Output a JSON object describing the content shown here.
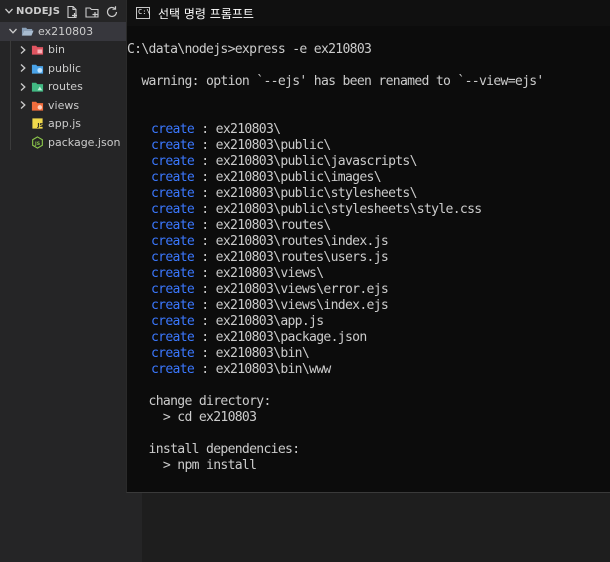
{
  "explorer": {
    "root_title": "NODEJS",
    "project": "ex210803",
    "items": [
      {
        "name": "bin",
        "type": "folder",
        "icon": "bin-folder-icon",
        "color": "#e05561"
      },
      {
        "name": "public",
        "type": "folder",
        "icon": "public-folder-icon",
        "color": "#4aa3e8"
      },
      {
        "name": "routes",
        "type": "folder",
        "icon": "routes-folder-icon",
        "color": "#42b983"
      },
      {
        "name": "views",
        "type": "folder",
        "icon": "views-folder-icon",
        "color": "#f26d3d"
      },
      {
        "name": "app.js",
        "type": "file",
        "icon": "javascript-file-icon",
        "color": "#f1d94b"
      },
      {
        "name": "package.json",
        "type": "file",
        "icon": "nodejs-file-icon",
        "color": "#8cc84b"
      }
    ]
  },
  "cmd": {
    "icon_text": "C:\\",
    "title": "선택 명령 프롬프트",
    "command_line": "C:\\data\\nodejs>express -e ex210803",
    "warning": "  warning: option `--ejs' has been renamed to `--view=ejs'",
    "create_label": "create",
    "separator": " : ",
    "created": [
      "ex210803\\",
      "ex210803\\public\\",
      "ex210803\\public\\javascripts\\",
      "ex210803\\public\\images\\",
      "ex210803\\public\\stylesheets\\",
      "ex210803\\public\\stylesheets\\style.css",
      "ex210803\\routes\\",
      "ex210803\\routes\\index.js",
      "ex210803\\routes\\users.js",
      "ex210803\\views\\",
      "ex210803\\views\\error.ejs",
      "ex210803\\views\\index.ejs",
      "ex210803\\app.js",
      "ex210803\\package.json",
      "ex210803\\bin\\",
      "ex210803\\bin\\www"
    ],
    "change_directory_label": "   change directory:",
    "change_directory_cmd": "     > cd ex210803",
    "install_label": "   install dependencies:",
    "install_cmd": "     > npm install"
  },
  "colors": {
    "keyword_blue": "#3b78ff",
    "console_text": "#cccccc",
    "console_bg": "#0c0c0c"
  }
}
